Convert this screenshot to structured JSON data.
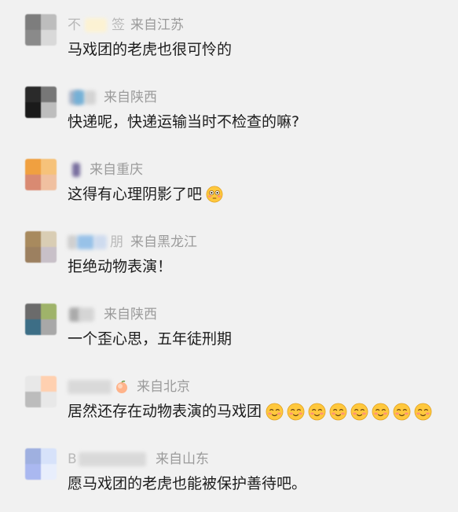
{
  "comments": [
    {
      "nick_visible": "不",
      "nick_visible_2": "签",
      "location": "来自江苏",
      "text": "马戏团的老虎也很可怜的",
      "avatar_colors": [
        "#7d7d7d",
        "#bdbdbd",
        "#8a8a8a",
        "#d9d9d9"
      ]
    },
    {
      "nick_visible": "",
      "nick_visible_2": "",
      "location": "来自陕西",
      "text": "快递呢，快递运输当时不检查的嘛?",
      "avatar_colors": [
        "#2a2a2a",
        "#777777",
        "#1a1a1a",
        "#bdbdbd"
      ]
    },
    {
      "nick_visible": "",
      "nick_visible_2": "",
      "location": "来自重庆",
      "text": "这得有心理阴影了吧",
      "emoji": "flushed-face",
      "avatar_colors": [
        "#f0a040",
        "#f6c27a",
        "#d98a72",
        "#f0c0a0"
      ]
    },
    {
      "nick_visible": "",
      "nick_visible_2": "朋",
      "location": "来自黑龙江",
      "text": "拒绝动物表演！",
      "avatar_colors": [
        "#a88a5e",
        "#d9cdb4",
        "#9c8060",
        "#c8c0c8"
      ]
    },
    {
      "nick_visible": "",
      "nick_visible_2": "",
      "location": "来自陕西",
      "text": "一个歪心思，五年徒刑期",
      "avatar_colors": [
        "#6b6b6b",
        "#9fb36a",
        "#3d6e86",
        "#a8a8a8"
      ]
    },
    {
      "nick_visible": "",
      "nick_visible_2": "",
      "location": "来自北京",
      "text": "居然还存在动物表演的马戏团",
      "emoji_repeat": 8,
      "emoji": "blushing-face",
      "avatar_colors": [
        "#e8e8e8",
        "#ffd0b0",
        "#bcbcbc",
        "#e8e8e8"
      ]
    },
    {
      "nick_visible": "B",
      "nick_visible_2": "",
      "location": "来自山东",
      "text": "愿马戏团的老虎也能被保护善待吧。",
      "avatar_colors": [
        "#9fb0e0",
        "#d7e2fa",
        "#aab8f0",
        "#e8eefc"
      ]
    }
  ],
  "colors": {
    "background": "#f1f1f1",
    "text": "#1d1d1d",
    "meta": "#9b9b9b",
    "emoji_face": "#ffc83d"
  }
}
